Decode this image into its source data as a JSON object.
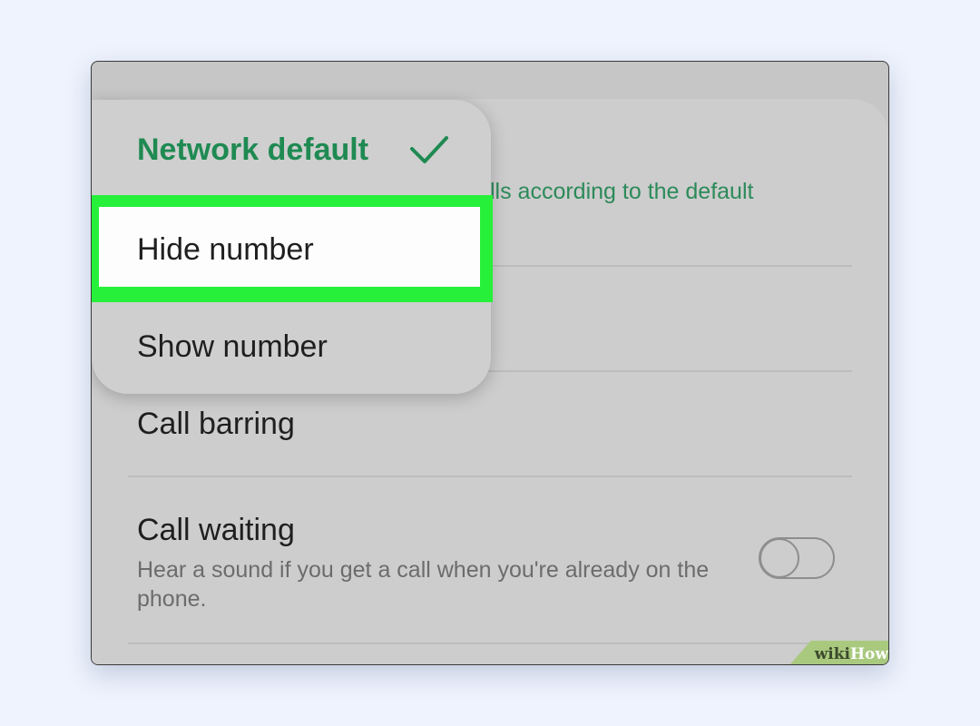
{
  "menu": {
    "items": [
      {
        "label": "Network default",
        "selected": true
      },
      {
        "label": "Hide number",
        "selected": false,
        "highlighted": true
      },
      {
        "label": "Show number",
        "selected": false
      }
    ]
  },
  "settings": {
    "caller_id_partial_sub": "lls according to the default",
    "call_barring": {
      "title": "Call barring"
    },
    "call_waiting": {
      "title": "Call waiting",
      "subtitle": "Hear a sound if you get a call when you're already on the phone.",
      "enabled": false
    }
  },
  "watermark": {
    "part1": "wiki",
    "part2": "How"
  },
  "colors": {
    "accent_green": "#1f8a52",
    "highlight_green": "#27f03a",
    "page_background": "#eef3fd"
  },
  "icons": {
    "selected_check": "check-icon"
  }
}
